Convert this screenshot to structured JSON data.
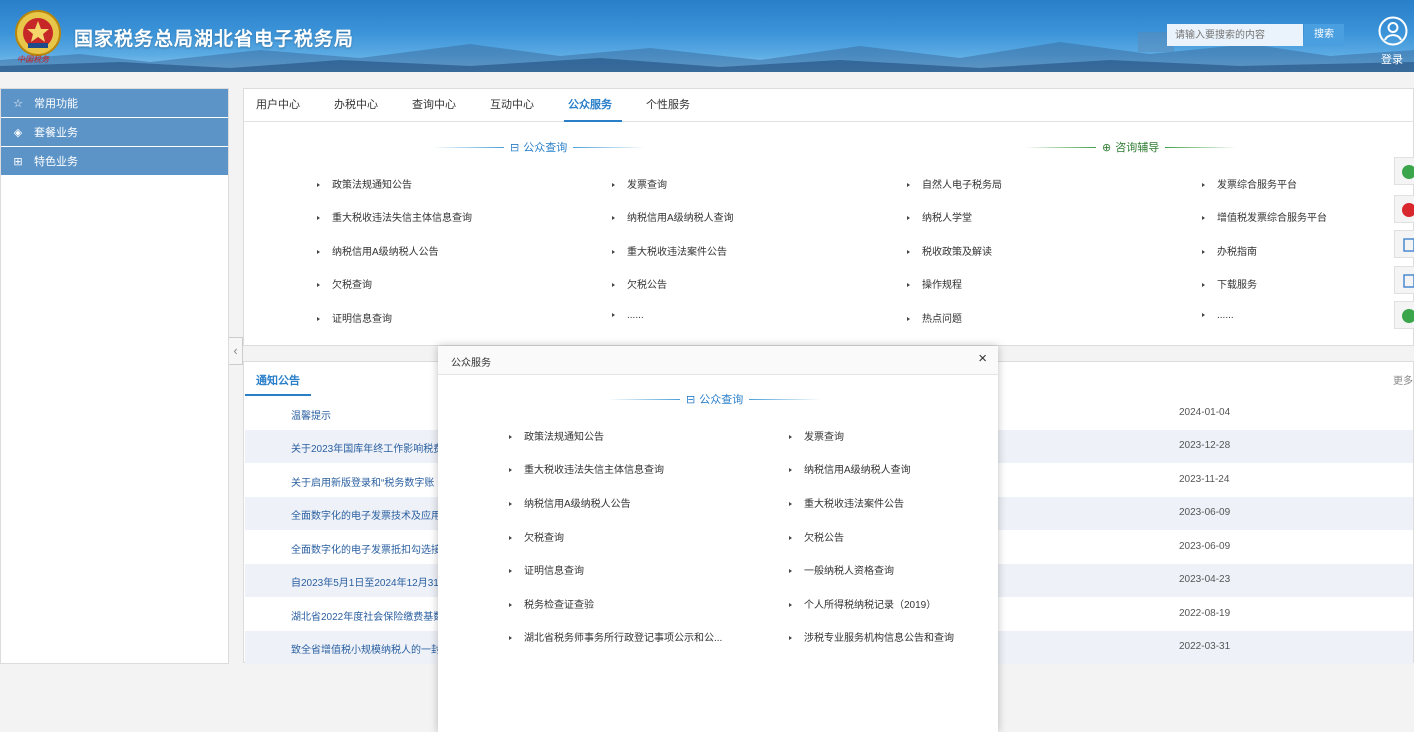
{
  "header": {
    "site_title": "国家税务总局湖北省电子税务局",
    "emblem_caption": "中国税务",
    "search_placeholder": "请输入要搜索的内容",
    "search_button": "搜索",
    "login_label": "登录"
  },
  "sidebar": {
    "items": [
      {
        "label": "常用功能",
        "icon": "star-icon"
      },
      {
        "label": "套餐业务",
        "icon": "layers-icon"
      },
      {
        "label": "特色业务",
        "icon": "grid-icon"
      }
    ]
  },
  "tabs": [
    "用户中心",
    "办税中心",
    "查询中心",
    "互动中心",
    "公众服务",
    "个性服务"
  ],
  "active_tab": "公众服务",
  "public_query": {
    "title": "公众查询",
    "col1": [
      "政策法规通知公告",
      "重大税收违法失信主体信息查询",
      "纳税信用A级纳税人公告",
      "欠税查询",
      "证明信息查询"
    ],
    "col2": [
      "发票查询",
      "纳税信用A级纳税人查询",
      "重大税收违法案件公告",
      "欠税公告",
      "......"
    ]
  },
  "consult": {
    "title": "咨询辅导",
    "col1": [
      "自然人电子税务局",
      "纳税人学堂",
      "税收政策及解读",
      "操作规程",
      "热点问题"
    ],
    "col2": [
      "发票综合服务平台",
      "增值税发票综合服务平台",
      "办税指南",
      "下载服务",
      "......"
    ]
  },
  "notice": {
    "tab": "通知公告",
    "more": "更多",
    "rows": [
      {
        "title": "温馨提示",
        "date": "2024-01-04"
      },
      {
        "title": "关于2023年国库年终工作影响税费",
        "date": "2023-12-28"
      },
      {
        "title": "关于启用新版登录和“税务数字账",
        "date": "2023-11-24"
      },
      {
        "title": "全面数字化的电子发票技术及应用",
        "date": "2023-06-09"
      },
      {
        "title": "全面数字化的电子发票抵扣勾选接",
        "date": "2023-06-09"
      },
      {
        "title": "自2023年5月1日至2024年12月31",
        "date": "2023-04-23"
      },
      {
        "title": "湖北省2022年度社会保险缴费基数",
        "date": "2022-08-19"
      },
      {
        "title": "致全省增值税小规模纳税人的一封",
        "date": "2022-03-31"
      }
    ]
  },
  "modal": {
    "title": "公众服务",
    "section_title": "公众查询",
    "col1": [
      "政策法规通知公告",
      "重大税收违法失信主体信息查询",
      "纳税信用A级纳税人公告",
      "欠税查询",
      "证明信息查询",
      "税务检查证查验",
      "湖北省税务师事务所行政登记事项公示和公..."
    ],
    "col2": [
      "发票查询",
      "纳税信用A级纳税人查询",
      "重大税收违法案件公告",
      "欠税公告",
      "一般纳税人资格查询",
      "个人所得税纳税记录（2019）",
      "涉税专业服务机构信息公告和查询"
    ]
  },
  "colors": {
    "header_blue": "#2a7fc9",
    "sidebar_blue": "#5d94c8",
    "consult_green": "#43a047"
  }
}
